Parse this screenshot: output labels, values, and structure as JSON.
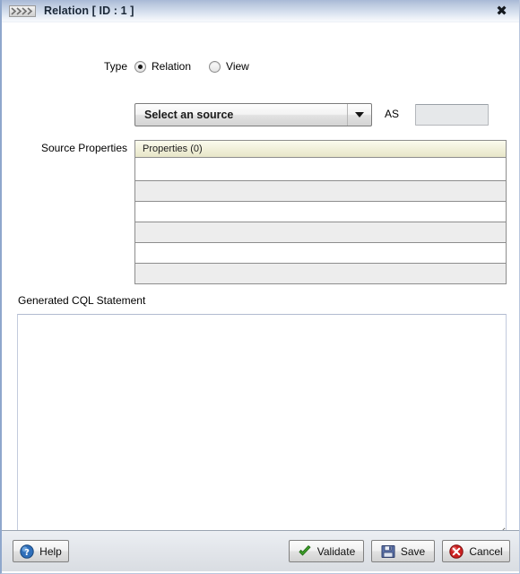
{
  "window": {
    "title": "Relation [ ID : 1 ]",
    "icon": "chevrons-icon",
    "close_label": "✖"
  },
  "form": {
    "type": {
      "label": "Type",
      "options": [
        {
          "label": "Relation",
          "selected": true
        },
        {
          "label": "View",
          "selected": false
        }
      ]
    },
    "source": {
      "combo_value": "Select an source",
      "as_label": "AS",
      "as_value": "",
      "as_placeholder": ""
    },
    "source_properties": {
      "label": "Source Properties",
      "column_header": "Properties (0)",
      "rows": []
    },
    "cql": {
      "label": "Generated CQL Statement",
      "value": "",
      "placeholder": ""
    }
  },
  "footer": {
    "help_label": "Help",
    "validate_label": "Validate",
    "save_label": "Save",
    "cancel_label": "Cancel"
  },
  "colors": {
    "titlebar_start": "#a8b9d6",
    "titlebar_end": "#f8fafd",
    "table_header": "#f2f1dc",
    "row_alt": "#ededed",
    "help_icon": "#2f6fba",
    "validate_icon": "#3fa02b",
    "save_icon": "#5d74ad",
    "cancel_icon": "#cc2020"
  }
}
